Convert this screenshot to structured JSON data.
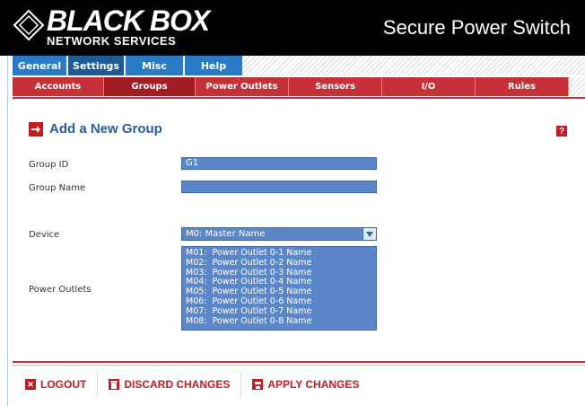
{
  "brand": {
    "logo_main": "BLACK BOX",
    "logo_sub": "NETWORK SERVICES",
    "product": "Secure Power Switch"
  },
  "nav_primary": [
    {
      "label": "General"
    },
    {
      "label": "Settings"
    },
    {
      "label": "Misc"
    },
    {
      "label": "Help"
    }
  ],
  "nav_secondary": [
    {
      "label": "Accounts"
    },
    {
      "label": "Groups"
    },
    {
      "label": "Power Outlets"
    },
    {
      "label": "Sensors"
    },
    {
      "label": "I/O"
    },
    {
      "label": "Rules"
    }
  ],
  "page": {
    "title": "Add a New Group",
    "help_icon": "?"
  },
  "form": {
    "group_id_label": "Group ID",
    "group_id_value": "G1",
    "group_name_label": "Group Name",
    "group_name_value": "",
    "device_label": "Device",
    "device_value": "M0:  Master Name",
    "outlets_label": "Power Outlets",
    "outlets": [
      "M01:  Power Outlet 0-1 Name",
      "M02:  Power Outlet 0-2 Name",
      "M03:  Power Outlet 0-3 Name",
      "M04:  Power Outlet 0-4 Name",
      "M05:  Power Outlet 0-5 Name",
      "M06:  Power Outlet 0-6 Name",
      "M07:  Power Outlet 0-7 Name",
      "M08:  Power Outlet 0-8 Name"
    ]
  },
  "actions": {
    "logout": "LOGOUT",
    "discard": "DISCARD CHANGES",
    "apply": "APPLY CHANGES"
  },
  "colors": {
    "blue_tab": "#2a7bc6",
    "red_tab": "#c63038",
    "field_blue": "#5b87c9",
    "title_blue": "#2c5c9c"
  }
}
